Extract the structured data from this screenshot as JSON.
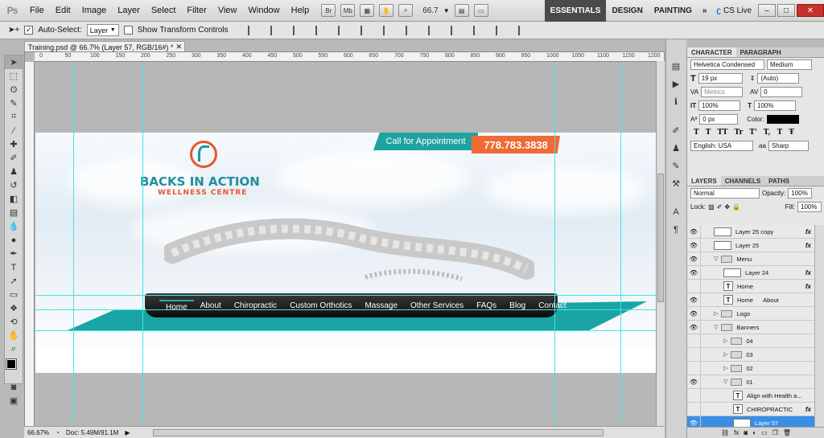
{
  "app": {
    "logo": "Ps",
    "menus": [
      "File",
      "Edit",
      "Image",
      "Layer",
      "Select",
      "Filter",
      "View",
      "Window",
      "Help"
    ],
    "zoom_value": "66.7",
    "bridge": "Br",
    "minibridge": "Mb"
  },
  "workspaces": {
    "items": [
      "ESSENTIALS",
      "DESIGN",
      "PAINTING"
    ],
    "active": "ESSENTIALS",
    "more": "»",
    "cslive": "CS Live"
  },
  "options": {
    "auto_select_label": "Auto-Select:",
    "auto_select_value": "Layer",
    "transform_label": "Show Transform Controls"
  },
  "document": {
    "tab_title": "Training.psd @ 66.7% (Layer 57, RGB/16#) *",
    "zoom_status": "66.67%",
    "doc_status": "Doc: 5.49M/91.1M"
  },
  "ruler": {
    "labels": [
      "0",
      "50",
      "100",
      "150",
      "200",
      "250",
      "300",
      "350",
      "400",
      "450",
      "500",
      "550",
      "600",
      "650",
      "700",
      "750",
      "800",
      "850",
      "900",
      "950",
      "1000",
      "1050",
      "1100",
      "1150",
      "1200"
    ]
  },
  "site": {
    "logo_name": "BACKS IN ACTION",
    "logo_sub": "WELLNESS CENTRE",
    "call_label": "Call for Appointment",
    "phone": "778.783.3838",
    "nav": [
      "Home",
      "About",
      "Chiropractic",
      "Custom Orthotics",
      "Massage",
      "Other Services",
      "FAQs",
      "Blog",
      "Contact"
    ],
    "colors": {
      "teal": "#1aa5a4",
      "orange": "#ef6a35"
    }
  },
  "character": {
    "tabs": [
      "CHARACTER",
      "PARAGRAPH"
    ],
    "font_family": "Helvetica Condensed",
    "font_style": "Medium",
    "size": "19 px",
    "leading": "(Auto)",
    "kerning": "Metrics",
    "tracking": "0",
    "vscale": "100%",
    "hscale": "100%",
    "baseline": "0 px",
    "color_label": "Color:",
    "styles": [
      "T",
      "T",
      "TT",
      "Tr",
      "T'",
      "T,",
      "T",
      "Ŧ"
    ],
    "language": "English: USA",
    "aa_label": "aa",
    "antialias": "Sharp"
  },
  "layers_panel": {
    "tabs": [
      "LAYERS",
      "CHANNELS",
      "PATHS"
    ],
    "blend": "Normal",
    "opacity_label": "Opacity:",
    "opacity": "100%",
    "lock_label": "Lock:",
    "fill_label": "Fill:",
    "fill": "100%",
    "rows": [
      {
        "name": "Layer 25 copy",
        "kind": "pixel",
        "fx": "fx",
        "eye": true,
        "indent": 1
      },
      {
        "name": "Layer 25",
        "kind": "pixel",
        "fx": "fx",
        "eye": true,
        "indent": 1
      },
      {
        "name": "Menu",
        "kind": "group",
        "open": true,
        "eye": true,
        "indent": 1
      },
      {
        "name": "Layer 24",
        "kind": "pixel",
        "fx": "fx",
        "eye": true,
        "indent": 2
      },
      {
        "name": "Home",
        "kind": "text",
        "fx": "fx",
        "eye": false,
        "indent": 2
      },
      {
        "name": "Home      About",
        "kind": "text",
        "fx": "",
        "eye": true,
        "indent": 2
      },
      {
        "name": "Logo",
        "kind": "group",
        "open": false,
        "eye": true,
        "indent": 1
      },
      {
        "name": "Banners",
        "kind": "group",
        "open": true,
        "eye": true,
        "indent": 1
      },
      {
        "name": "04",
        "kind": "group",
        "open": false,
        "eye": false,
        "indent": 2
      },
      {
        "name": "03",
        "kind": "group",
        "open": false,
        "eye": false,
        "indent": 2
      },
      {
        "name": "02",
        "kind": "group",
        "open": false,
        "eye": false,
        "indent": 2
      },
      {
        "name": "01",
        "kind": "group",
        "open": true,
        "eye": true,
        "indent": 2
      },
      {
        "name": "Align with Health a...",
        "kind": "text",
        "fx": "",
        "eye": false,
        "indent": 3
      },
      {
        "name": "CHIROPRACTIC",
        "kind": "text",
        "fx": "fx",
        "eye": false,
        "indent": 3
      },
      {
        "name": "Layer 57",
        "kind": "pixel",
        "fx": "",
        "eye": true,
        "indent": 3,
        "selected": true
      }
    ]
  }
}
